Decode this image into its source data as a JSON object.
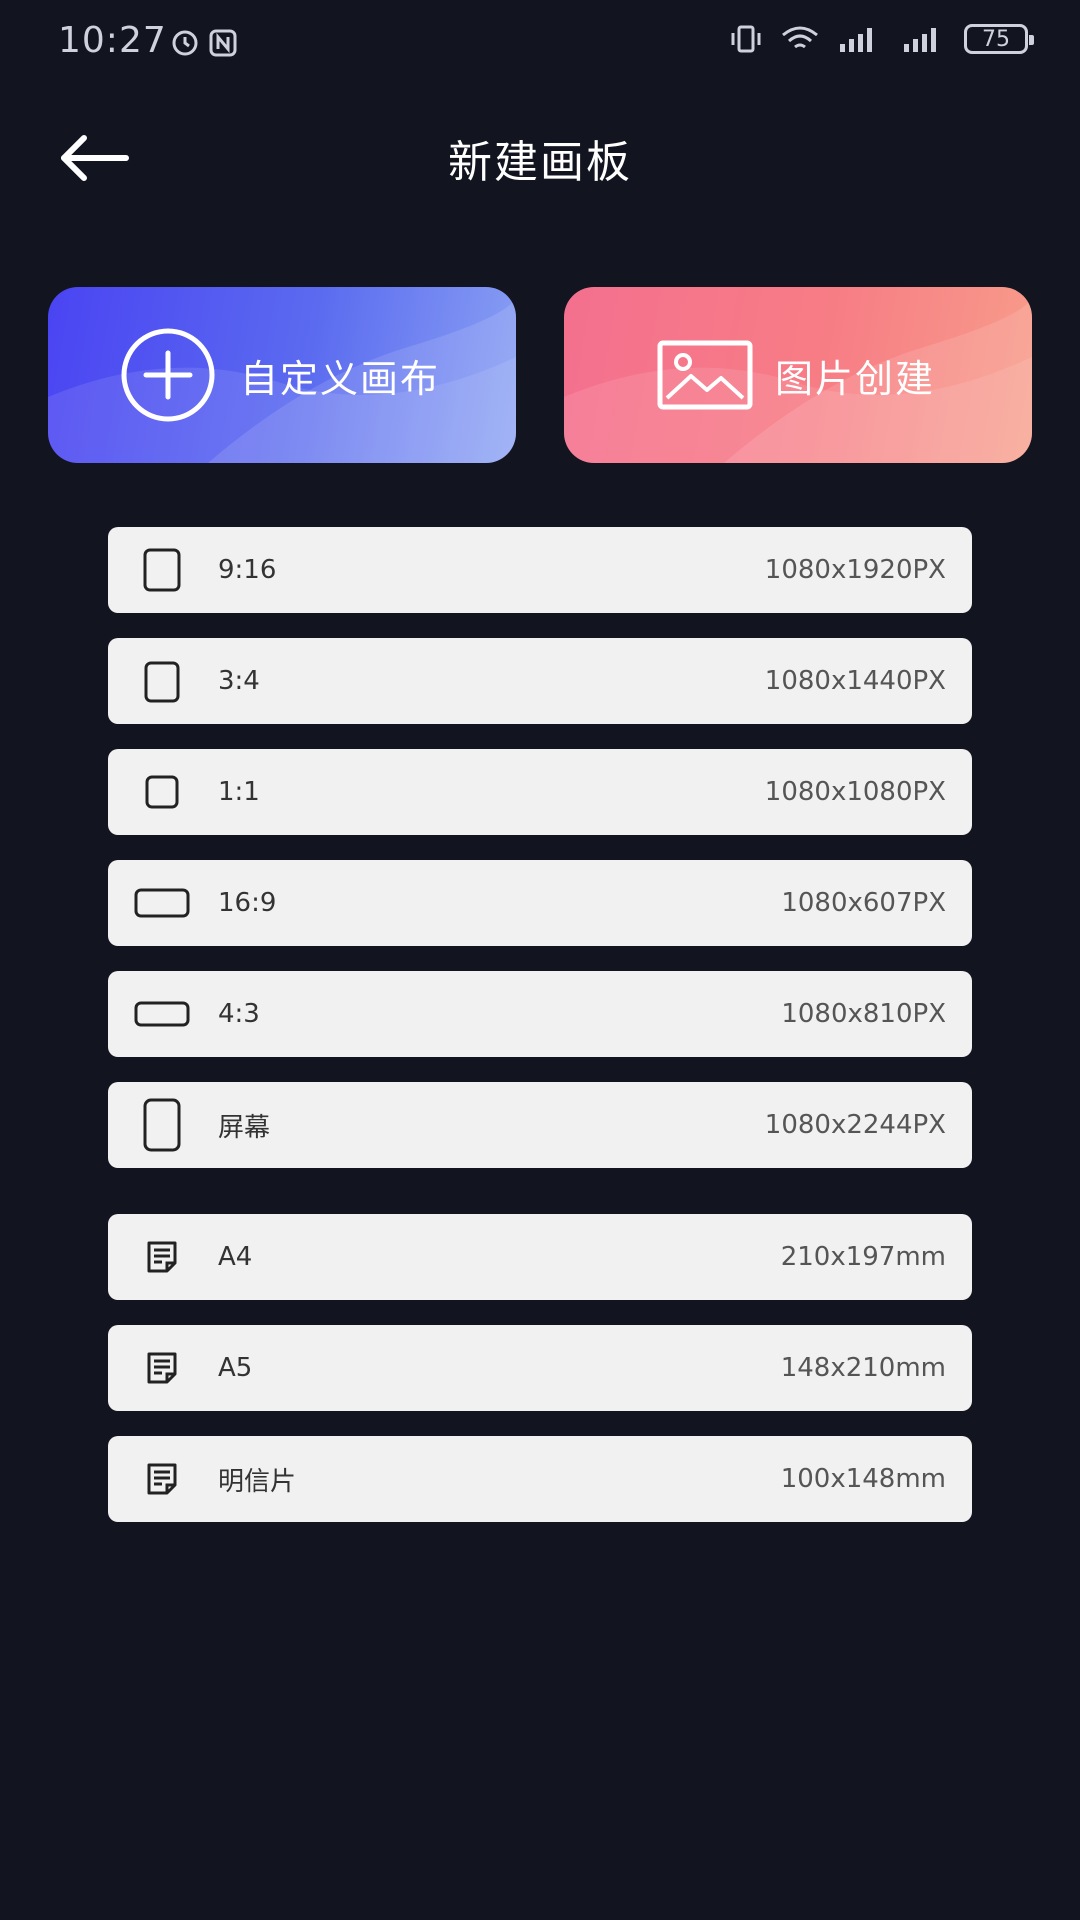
{
  "status_bar": {
    "time": "10:27",
    "battery": "75"
  },
  "header": {
    "title": "新建画板"
  },
  "actions": {
    "custom_canvas": "自定义画布",
    "image_create": "图片创建"
  },
  "screen_presets": [
    {
      "label": "9:16",
      "size": "1080x1920PX",
      "icon": "portrait-tall-icon"
    },
    {
      "label": "3:4",
      "size": "1080x1440PX",
      "icon": "portrait-icon"
    },
    {
      "label": "1:1",
      "size": "1080x1080PX",
      "icon": "square-icon"
    },
    {
      "label": "16:9",
      "size": "1080x607PX",
      "icon": "landscape-wide-icon"
    },
    {
      "label": "4:3",
      "size": "1080x810PX",
      "icon": "landscape-icon"
    },
    {
      "label": "屏幕",
      "size": "1080x2244PX",
      "icon": "phone-screen-icon"
    }
  ],
  "paper_presets": [
    {
      "label": "A4",
      "size": "210x197mm",
      "icon": "document-icon"
    },
    {
      "label": "A5",
      "size": "148x210mm",
      "icon": "document-icon"
    },
    {
      "label": "明信片",
      "size": "100x148mm",
      "icon": "document-icon"
    }
  ],
  "colors": {
    "background": "#12141f",
    "row_background": "#f1f1f2",
    "custom_card_gradient_start": "#4a44f2",
    "custom_card_gradient_end": "#8aa1f3",
    "image_card_gradient_start": "#f4708f",
    "image_card_gradient_end": "#f79d8a"
  }
}
